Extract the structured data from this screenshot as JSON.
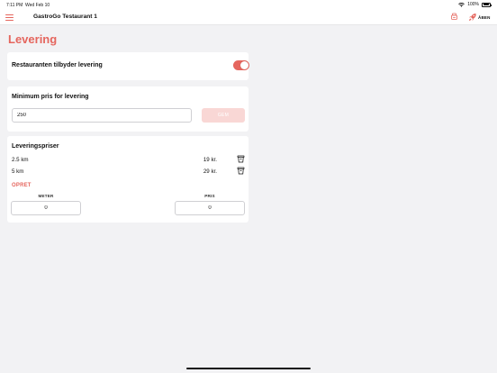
{
  "status_bar": {
    "time": "7:11 PM",
    "date": "Wed Feb 10",
    "battery": "100%"
  },
  "nav": {
    "title": "GastroGo Testaurant 1",
    "open_label": "ÅBEN"
  },
  "page": {
    "title": "Levering"
  },
  "delivery_toggle": {
    "label": "Restauranten tilbyder levering",
    "enabled": true
  },
  "minimum_price": {
    "label": "Minimum pris for levering",
    "value": "250",
    "save_label": "GEM"
  },
  "delivery_prices": {
    "label": "Leveringspriser",
    "rows": [
      {
        "distance": "2.5 km",
        "price": "19 kr."
      },
      {
        "distance": "5 km",
        "price": "29 kr."
      }
    ],
    "create_label": "OPRET",
    "meter_label": "METER",
    "pris_label": "PRIS",
    "meter_value": "0",
    "pris_value": "0"
  },
  "colors": {
    "accent": "#e5665e",
    "accent_light": "#f9d7d5",
    "background": "#f2f2f4"
  },
  "icons": {
    "menu": "hamburger-menu-icon",
    "pos": "cash-register-icon",
    "rocket": "rocket-icon",
    "trash": "trash-icon",
    "wifi": "wifi-icon",
    "battery": "battery-icon"
  }
}
